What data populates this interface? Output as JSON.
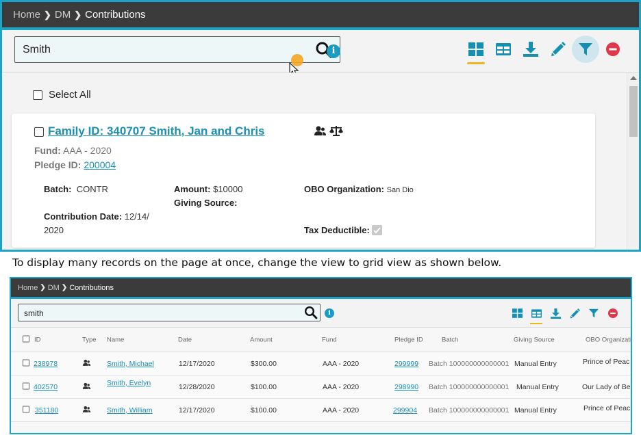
{
  "top": {
    "breadcrumb": {
      "home": "Home",
      "dm": "DM",
      "current": "Contributions"
    },
    "search": {
      "value": "Smith"
    },
    "select_all": "Select All",
    "card": {
      "title": "Family ID: 340707 Smith, Jan and Chris",
      "fund_label": "Fund:",
      "fund_value": "AAA - 2020",
      "pledge_label": "Pledge ID:",
      "pledge_value": "200004",
      "batch_label": "Batch:",
      "batch_value": "CONTR",
      "amount_label": "Amount:",
      "amount_value": "$10000",
      "obo_label": "OBO Organization:",
      "obo_value": "San Dio",
      "giving_label": "Giving Source:",
      "date_label": "Contribution Date:",
      "date_value_1": "12/14/",
      "date_value_2": "2020",
      "tax_label": "Tax Deductible:",
      "tax_checked": true
    },
    "toolbar_icons": [
      "tile-view-icon",
      "grid-view-icon",
      "download-icon",
      "edit-icon",
      "filter-icon",
      "delete-icon"
    ],
    "colors": {
      "accent": "#1ea3c6",
      "link": "#1a8fb7",
      "active_underline": "#f0b323",
      "delete": "#e0384b"
    }
  },
  "caption": "To display many records on the page at once, change the view to grid view as shown below.",
  "bottom": {
    "breadcrumb": {
      "home": "Home",
      "dm": "DM",
      "current": "Contributions"
    },
    "search": {
      "value": "smith"
    },
    "columns": [
      "ID",
      "Type",
      "Name",
      "Date",
      "Amount",
      "Fund",
      "Pledge ID",
      "Batch",
      "Giving Source",
      "OBO Organizati"
    ],
    "rows": [
      {
        "id": "238978",
        "name": "Smith, Michael",
        "date": "12/17/2020",
        "amount": "$300.00",
        "fund": "AAA - 2020",
        "pledge": "299999",
        "batch": "Batch 100000000000001",
        "source": "Manual Entry",
        "obo": "Prince of Peac"
      },
      {
        "id": "402570",
        "name": "Smith, Evelyn",
        "date": "12/28/2020",
        "amount": "$100.00",
        "fund": "AAA - 2020",
        "pledge": "298990",
        "batch": "Batch 100000000000001",
        "source": "Manual Entry",
        "obo": "Our Lady of Be"
      },
      {
        "id": "351180",
        "name": "Smith, William",
        "date": "12/17/2020",
        "amount": "$100.00",
        "fund": "AAA - 2020",
        "pledge": "299904",
        "batch": "Batch 100000000000001",
        "source": "Manual Entry",
        "obo": "Prince of Peac"
      }
    ]
  }
}
